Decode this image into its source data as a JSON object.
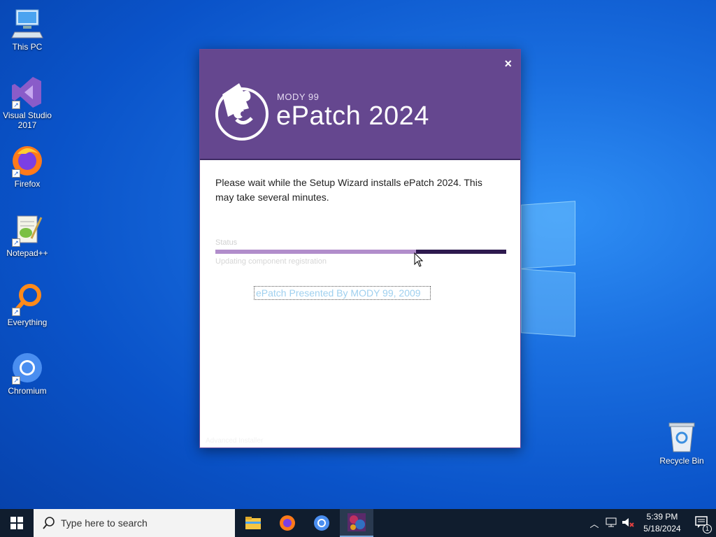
{
  "desktop": {
    "icons": [
      {
        "label": "This PC"
      },
      {
        "label": "Visual Studio 2017"
      },
      {
        "label": "Firefox"
      },
      {
        "label": "Notepad++"
      },
      {
        "label": "Everything"
      },
      {
        "label": "Chromium"
      },
      {
        "label": "Recycle Bin"
      }
    ]
  },
  "dialog": {
    "brand": "MODY 99",
    "title": "ePatch 2024",
    "close": "×",
    "message": "Please wait while the Setup Wizard installs ePatch 2024.  This may take several minutes.",
    "status_label": "Status",
    "progress": 0.69,
    "sub_status": "Updating component registration",
    "link": "ePatch Presented By MODY 99, 2009",
    "footer": "Advanced Installer"
  },
  "taskbar": {
    "search_placeholder": "Type here to search",
    "apps": [
      "file-explorer",
      "firefox",
      "chromium",
      "epatch-installer"
    ],
    "clock_time": "5:39 PM",
    "clock_date": "5/18/2024",
    "notification_count": "1"
  },
  "colors": {
    "header": "#65478f",
    "progress_fill": "#b18dcb",
    "progress_track": "#2e1a4f",
    "taskbar": "#101d2e"
  }
}
